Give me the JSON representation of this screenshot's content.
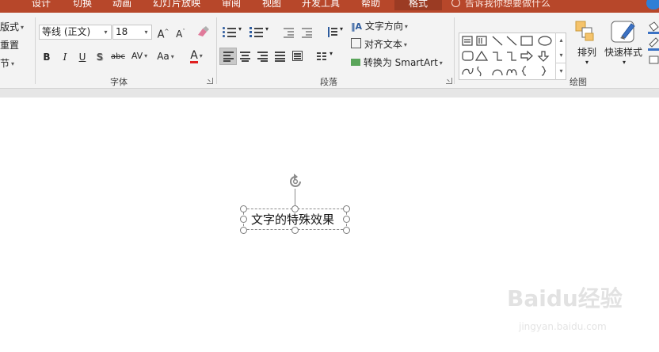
{
  "tabs": [
    "设计",
    "切换",
    "动画",
    "幻灯片放映",
    "审阅",
    "视图",
    "开发工具",
    "帮助",
    "格式"
  ],
  "active_tab": "格式",
  "tell_me": "告诉我你想要做什么",
  "slides_group": {
    "layout_label": "版式",
    "reset_label": "重置",
    "section_label": "节"
  },
  "font_group": {
    "label": "字体",
    "font_name": "等线 (正文)",
    "font_size": "18",
    "grow_label": "A",
    "shrink_label": "A",
    "bold": "B",
    "italic": "I",
    "underline": "U",
    "shadow": "S",
    "strike": "abc",
    "spacing": "AV",
    "case": "Aa",
    "color_label": "A"
  },
  "paragraph_group": {
    "label": "段落",
    "text_direction": "文字方向",
    "align_text": "对齐文本",
    "convert_smartart": "转换为 SmartArt"
  },
  "drawing_group": {
    "label": "绘图",
    "arrange": "排列",
    "quick_styles": "快速样式"
  },
  "slide": {
    "textbox_text": "文字的特殊效果"
  },
  "watermark": {
    "main": "Baidu经验",
    "sub": "jingyan.baidu.com"
  },
  "colors": {
    "tab_bar": "#b7472a",
    "active_tab": "#9b3b23",
    "ribbon": "#f3f3f3",
    "font_color": "#e02020"
  }
}
